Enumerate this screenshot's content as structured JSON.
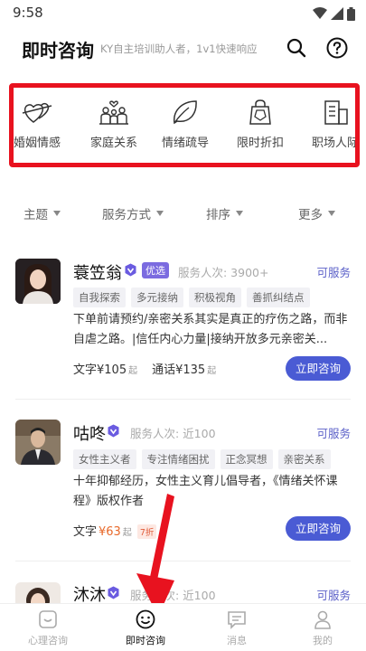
{
  "status": {
    "time": "9:58"
  },
  "header": {
    "title": "即时咨询",
    "subtitle": "KY自主培训助人者，1v1快速响应"
  },
  "categories": [
    {
      "label": "婚姻情感",
      "icon": "hearts-icon"
    },
    {
      "label": "家庭关系",
      "icon": "family-icon"
    },
    {
      "label": "情绪疏导",
      "icon": "leaf-icon"
    },
    {
      "label": "限时折扣",
      "icon": "shopping-bag-icon"
    },
    {
      "label": "职场人际",
      "icon": "building-icon"
    }
  ],
  "filters": [
    "主题",
    "服务方式",
    "排序",
    "更多"
  ],
  "counselors": [
    {
      "name": "蓑笠翁",
      "badge": "优选",
      "served": "服务人次: 3900+",
      "status": "可服务",
      "tags": [
        "自我探索",
        "多元接纳",
        "积极视角",
        "善抓纠结点"
      ],
      "description": "下单前请预约/亲密关系其实是真正的疗伤之路，而非自虐之路。|信任内心力量|接纳开放多元亲密关...",
      "text_price": "文字¥105",
      "text_unit": "起",
      "call_price": "通话¥135",
      "call_unit": "起",
      "button": "立即咨询"
    },
    {
      "name": "咕咚",
      "served": "服务人次: 近100",
      "status": "可服务",
      "tags": [
        "女性主义者",
        "专注情绪困扰",
        "正念冥想",
        "亲密关系"
      ],
      "description": "十年抑郁经历，女性主义育儿倡导者，《情绪关怀课程》版权作者",
      "text_price_prefix": "文字",
      "text_price": "¥63",
      "text_unit": "起",
      "discount": "7折",
      "button": "立即咨询"
    },
    {
      "name": "沐沐",
      "served": "服务人次: 近100",
      "status": "可服务"
    }
  ],
  "tabbar": [
    {
      "label": "心理咨询",
      "icon": "chat-square-icon"
    },
    {
      "label": "即时咨询",
      "icon": "smile-icon",
      "active": true
    },
    {
      "label": "消息",
      "icon": "message-icon"
    },
    {
      "label": "我的",
      "icon": "person-icon"
    }
  ]
}
